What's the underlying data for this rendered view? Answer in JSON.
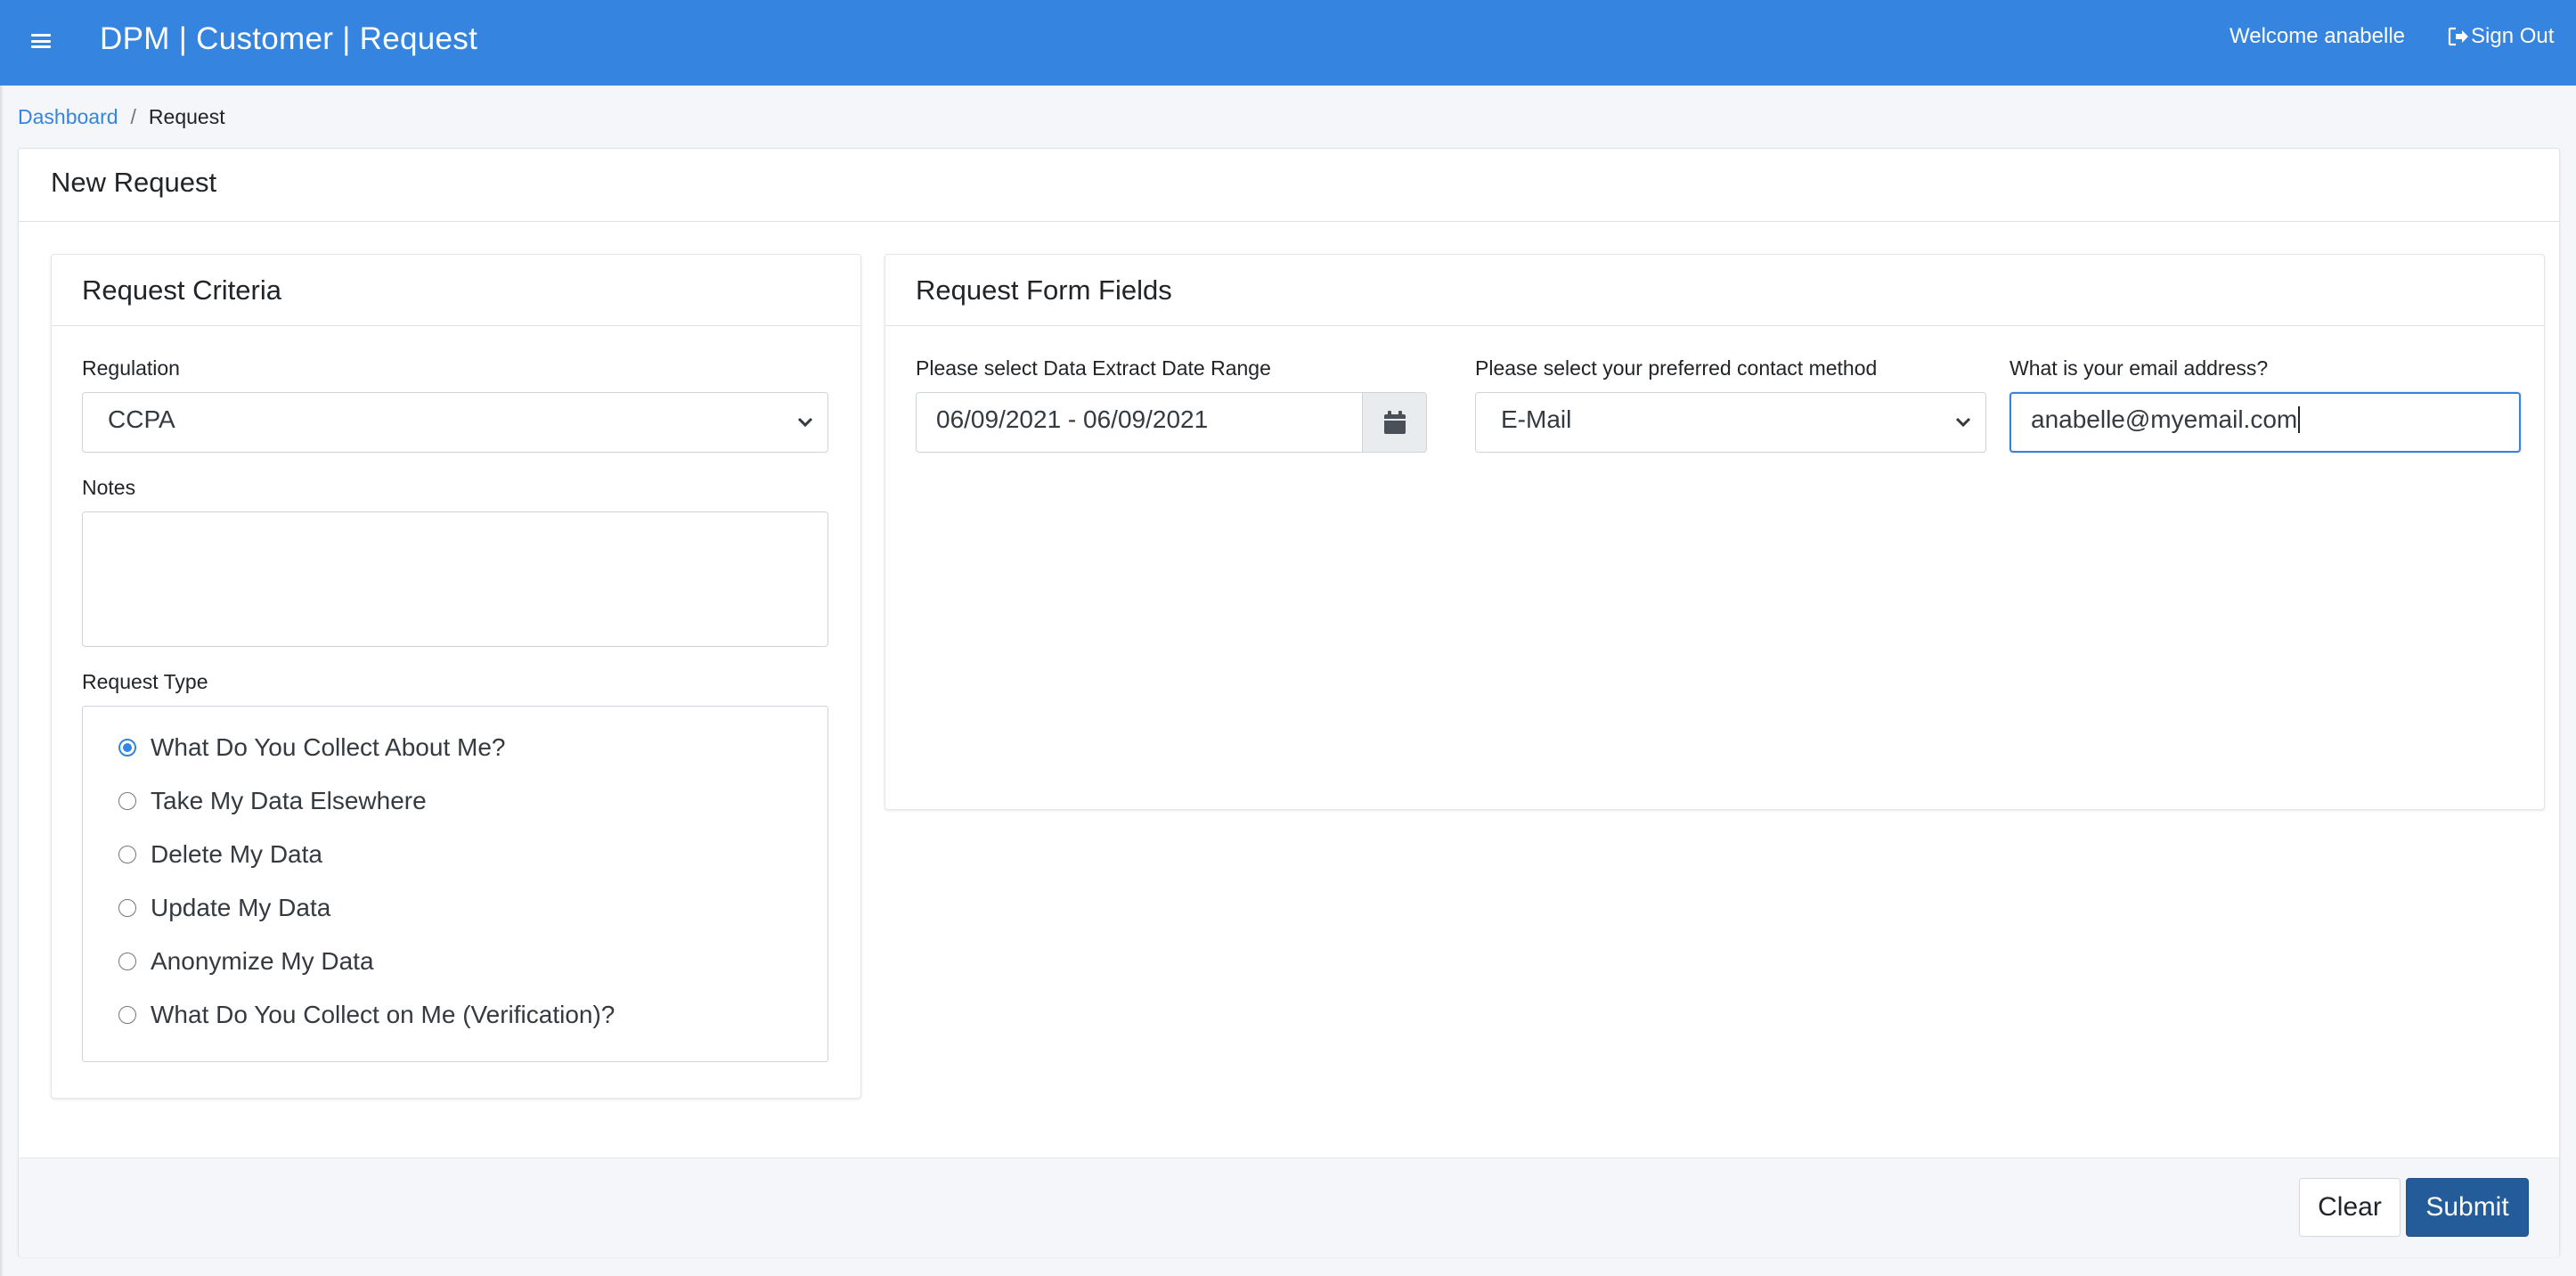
{
  "header": {
    "app_title": "DPM | Customer | Request",
    "welcome_text": "Welcome anabelle",
    "signout_label": "Sign Out"
  },
  "breadcrumb": {
    "items": [
      {
        "label": "Dashboard",
        "link": true
      },
      {
        "label": "Request",
        "link": false
      }
    ],
    "separator": "/"
  },
  "main": {
    "title": "New Request"
  },
  "criteria": {
    "title": "Request Criteria",
    "regulation_label": "Regulation",
    "regulation_value": "CCPA",
    "notes_label": "Notes",
    "notes_value": "",
    "request_type_label": "Request Type",
    "request_types": [
      {
        "label": "What Do You Collect About Me?",
        "checked": true
      },
      {
        "label": "Take My Data Elsewhere",
        "checked": false
      },
      {
        "label": "Delete My Data",
        "checked": false
      },
      {
        "label": "Update My Data",
        "checked": false
      },
      {
        "label": "Anonymize My Data",
        "checked": false
      },
      {
        "label": "What Do You Collect on Me (Verification)?",
        "checked": false
      }
    ]
  },
  "form_fields": {
    "title": "Request Form Fields",
    "date_range_label": "Please select Data Extract Date Range",
    "date_range_value": "06/09/2021 - 06/09/2021",
    "contact_method_label": "Please select your preferred contact method",
    "contact_method_value": "E-Mail",
    "email_label": "What is your email address?",
    "email_value": "anabelle@myemail.com"
  },
  "footer": {
    "clear_label": "Clear",
    "submit_label": "Submit"
  },
  "colors": {
    "topbar": "#3585e0",
    "link": "#3585e0",
    "submit": "#245c9a"
  },
  "icons": {
    "menu": "hamburger-icon",
    "signout": "sign-out-icon",
    "calendar": "calendar-icon",
    "dropdown": "chevron-down-icon"
  }
}
